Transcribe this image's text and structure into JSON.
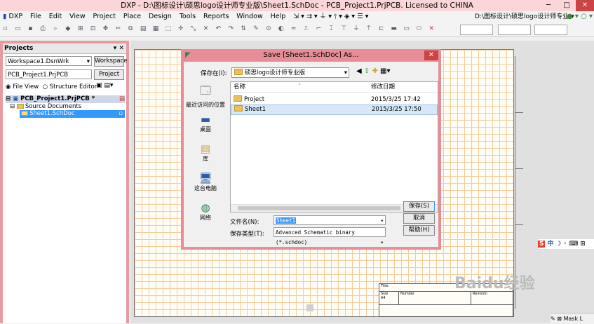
{
  "app": {
    "title": "DXP - D:\\图标设计\\硕思logo设计师专业版\\Sheet1.SchDoc - PCB_Project1.PrjPCB. Licensed to CHINA",
    "window_buttons": {
      "minimize": "─",
      "maximize": "□",
      "close": "✕"
    }
  },
  "menubar": {
    "items": [
      "DXP",
      "File",
      "Edit",
      "View",
      "Project",
      "Place",
      "Design",
      "Tools",
      "Reports",
      "Window",
      "Help"
    ],
    "path_combo": "D:\\图标设计\\硕思logo设计师专业 ▾"
  },
  "projects_panel": {
    "title": "Projects",
    "workspace_value": "Workspace1.DsnWrk",
    "workspace_button": "Workspace",
    "project_value": "PCB_Project1.PrjPCB",
    "project_button": "Project",
    "file_view_label": "File View",
    "structure_editor_label": "Structure Editor",
    "tree": {
      "project": "PCB_Project1.PrjPCB *",
      "folder": "Source Documents",
      "document": "Sheet1.SchDoc"
    }
  },
  "dialog": {
    "title": "Save [Sheet1.SchDoc] As...",
    "save_in_label": "保存在(I):",
    "save_in_value": "硕思logo设计师专业版",
    "places": [
      "最近访问的位置",
      "桌面",
      "库",
      "这台电脑",
      "网络"
    ],
    "columns": {
      "name": "名称",
      "date": "修改日期"
    },
    "files": [
      {
        "name": "Project",
        "date": "2015/3/25 17:42"
      },
      {
        "name": "Sheet1",
        "date": "2015/3/25 17:50"
      }
    ],
    "filename_label": "文件名(N):",
    "filename_value": "Sheet1",
    "filetype_label": "保存类型(T):",
    "filetype_value": "Advanced Schematic binary (*.schdoc)",
    "save_button": "保存(S)",
    "cancel_button": "取消",
    "help_button": "帮助(H)"
  },
  "title_block": {
    "title": "Title",
    "size": "Size",
    "size_value": "A4",
    "number": "Number",
    "revision": "Revision"
  },
  "ime": {
    "label": "中"
  },
  "watermark": {
    "text": "Baidu经验"
  },
  "status": {
    "mask": "Mask L"
  }
}
